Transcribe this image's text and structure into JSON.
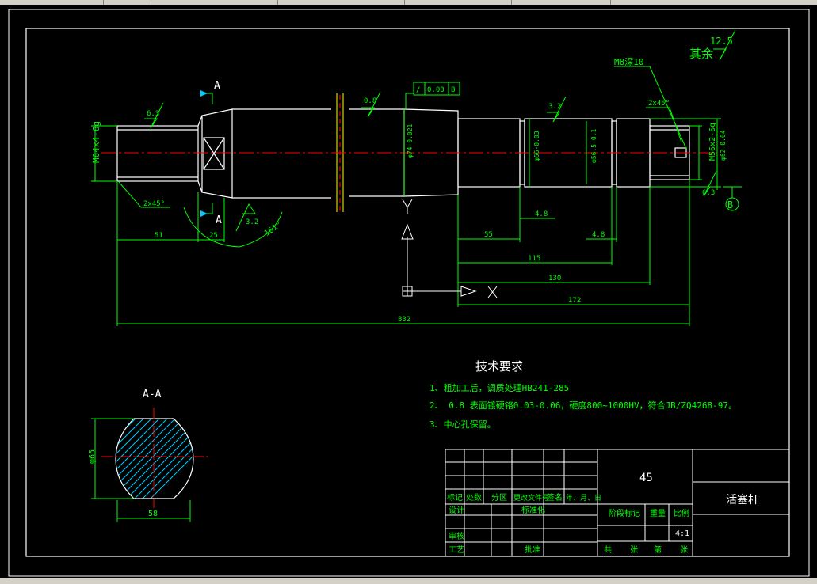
{
  "topbar": {
    "segments": 6
  },
  "drawing": {
    "roughness_other": {
      "label": "其余",
      "value": "12.5"
    },
    "thread_left": "M64x4-6g",
    "thread_right": "M56x2-6g",
    "m8_label": "M8深10",
    "chamfer_left": "2x45°",
    "chamfer_right": "2x45°",
    "tol_frame": {
      "symbol": "/",
      "value": "0.03",
      "datum": "B"
    },
    "section_marker": "A",
    "angle_label": "161°",
    "rough": {
      "r63_left": "6.3",
      "r08": "0.8",
      "r32_mid": "3.2",
      "r32_low": "3.2",
      "r63_right": "6.3"
    },
    "diameters": {
      "d74": "φ74-0.021",
      "d56_1": "φ56-0.03",
      "d56_2": "φ56.5-0.1",
      "d62": "φ62-0.04"
    },
    "dims": {
      "d51": "51",
      "d25": "25",
      "d55": "55",
      "d48a": "4.8",
      "d48b": "4.8",
      "d115": "115",
      "d130": "130",
      "d172": "172",
      "d832": "832"
    },
    "datum_b": "B",
    "axis_y": "Y",
    "axis_x": "X"
  },
  "section_view": {
    "title": "A-A",
    "dim_height": "φ65",
    "dim_width": "58"
  },
  "tech": {
    "title": "技术要求",
    "items": [
      "1、粗加工后，调质处理HB241-285",
      "2、 0.8 表面镀硬铬0.03-0.06，硬度800~1000HV，符合JB/ZQ4268-97。",
      "3、中心孔保留。"
    ]
  },
  "title_block": {
    "material": "45",
    "part_name": "活塞杆",
    "row_labels": [
      "标记",
      "处数",
      "分区",
      "更改文件号",
      "签名",
      "年、月、日"
    ],
    "design": "设计",
    "standardize": "标准化",
    "stage_mark": "阶段标记",
    "weight": "重量",
    "scale_label": "比例",
    "scale": "4:1",
    "review": "审核",
    "process": "工艺",
    "approve": "批准",
    "sheet_words": [
      "共",
      "张",
      "第",
      "张"
    ]
  }
}
